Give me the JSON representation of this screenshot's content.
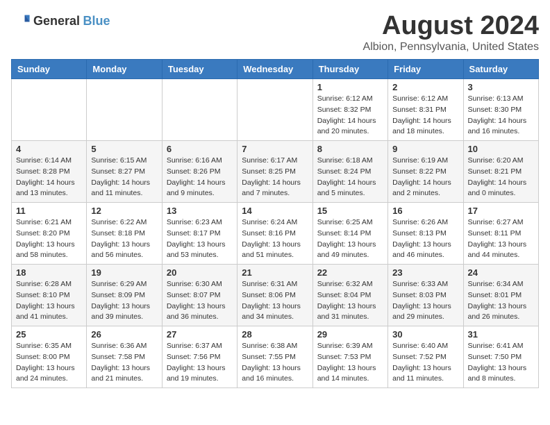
{
  "header": {
    "logo_general": "General",
    "logo_blue": "Blue",
    "title": "August 2024",
    "subtitle": "Albion, Pennsylvania, United States"
  },
  "weekdays": [
    "Sunday",
    "Monday",
    "Tuesday",
    "Wednesday",
    "Thursday",
    "Friday",
    "Saturday"
  ],
  "weeks": [
    [
      {
        "day": "",
        "sunrise": "",
        "sunset": "",
        "daylight": ""
      },
      {
        "day": "",
        "sunrise": "",
        "sunset": "",
        "daylight": ""
      },
      {
        "day": "",
        "sunrise": "",
        "sunset": "",
        "daylight": ""
      },
      {
        "day": "",
        "sunrise": "",
        "sunset": "",
        "daylight": ""
      },
      {
        "day": "1",
        "sunrise": "Sunrise: 6:12 AM",
        "sunset": "Sunset: 8:32 PM",
        "daylight": "Daylight: 14 hours and 20 minutes."
      },
      {
        "day": "2",
        "sunrise": "Sunrise: 6:12 AM",
        "sunset": "Sunset: 8:31 PM",
        "daylight": "Daylight: 14 hours and 18 minutes."
      },
      {
        "day": "3",
        "sunrise": "Sunrise: 6:13 AM",
        "sunset": "Sunset: 8:30 PM",
        "daylight": "Daylight: 14 hours and 16 minutes."
      }
    ],
    [
      {
        "day": "4",
        "sunrise": "Sunrise: 6:14 AM",
        "sunset": "Sunset: 8:28 PM",
        "daylight": "Daylight: 14 hours and 13 minutes."
      },
      {
        "day": "5",
        "sunrise": "Sunrise: 6:15 AM",
        "sunset": "Sunset: 8:27 PM",
        "daylight": "Daylight: 14 hours and 11 minutes."
      },
      {
        "day": "6",
        "sunrise": "Sunrise: 6:16 AM",
        "sunset": "Sunset: 8:26 PM",
        "daylight": "Daylight: 14 hours and 9 minutes."
      },
      {
        "day": "7",
        "sunrise": "Sunrise: 6:17 AM",
        "sunset": "Sunset: 8:25 PM",
        "daylight": "Daylight: 14 hours and 7 minutes."
      },
      {
        "day": "8",
        "sunrise": "Sunrise: 6:18 AM",
        "sunset": "Sunset: 8:24 PM",
        "daylight": "Daylight: 14 hours and 5 minutes."
      },
      {
        "day": "9",
        "sunrise": "Sunrise: 6:19 AM",
        "sunset": "Sunset: 8:22 PM",
        "daylight": "Daylight: 14 hours and 2 minutes."
      },
      {
        "day": "10",
        "sunrise": "Sunrise: 6:20 AM",
        "sunset": "Sunset: 8:21 PM",
        "daylight": "Daylight: 14 hours and 0 minutes."
      }
    ],
    [
      {
        "day": "11",
        "sunrise": "Sunrise: 6:21 AM",
        "sunset": "Sunset: 8:20 PM",
        "daylight": "Daylight: 13 hours and 58 minutes."
      },
      {
        "day": "12",
        "sunrise": "Sunrise: 6:22 AM",
        "sunset": "Sunset: 8:18 PM",
        "daylight": "Daylight: 13 hours and 56 minutes."
      },
      {
        "day": "13",
        "sunrise": "Sunrise: 6:23 AM",
        "sunset": "Sunset: 8:17 PM",
        "daylight": "Daylight: 13 hours and 53 minutes."
      },
      {
        "day": "14",
        "sunrise": "Sunrise: 6:24 AM",
        "sunset": "Sunset: 8:16 PM",
        "daylight": "Daylight: 13 hours and 51 minutes."
      },
      {
        "day": "15",
        "sunrise": "Sunrise: 6:25 AM",
        "sunset": "Sunset: 8:14 PM",
        "daylight": "Daylight: 13 hours and 49 minutes."
      },
      {
        "day": "16",
        "sunrise": "Sunrise: 6:26 AM",
        "sunset": "Sunset: 8:13 PM",
        "daylight": "Daylight: 13 hours and 46 minutes."
      },
      {
        "day": "17",
        "sunrise": "Sunrise: 6:27 AM",
        "sunset": "Sunset: 8:11 PM",
        "daylight": "Daylight: 13 hours and 44 minutes."
      }
    ],
    [
      {
        "day": "18",
        "sunrise": "Sunrise: 6:28 AM",
        "sunset": "Sunset: 8:10 PM",
        "daylight": "Daylight: 13 hours and 41 minutes."
      },
      {
        "day": "19",
        "sunrise": "Sunrise: 6:29 AM",
        "sunset": "Sunset: 8:09 PM",
        "daylight": "Daylight: 13 hours and 39 minutes."
      },
      {
        "day": "20",
        "sunrise": "Sunrise: 6:30 AM",
        "sunset": "Sunset: 8:07 PM",
        "daylight": "Daylight: 13 hours and 36 minutes."
      },
      {
        "day": "21",
        "sunrise": "Sunrise: 6:31 AM",
        "sunset": "Sunset: 8:06 PM",
        "daylight": "Daylight: 13 hours and 34 minutes."
      },
      {
        "day": "22",
        "sunrise": "Sunrise: 6:32 AM",
        "sunset": "Sunset: 8:04 PM",
        "daylight": "Daylight: 13 hours and 31 minutes."
      },
      {
        "day": "23",
        "sunrise": "Sunrise: 6:33 AM",
        "sunset": "Sunset: 8:03 PM",
        "daylight": "Daylight: 13 hours and 29 minutes."
      },
      {
        "day": "24",
        "sunrise": "Sunrise: 6:34 AM",
        "sunset": "Sunset: 8:01 PM",
        "daylight": "Daylight: 13 hours and 26 minutes."
      }
    ],
    [
      {
        "day": "25",
        "sunrise": "Sunrise: 6:35 AM",
        "sunset": "Sunset: 8:00 PM",
        "daylight": "Daylight: 13 hours and 24 minutes."
      },
      {
        "day": "26",
        "sunrise": "Sunrise: 6:36 AM",
        "sunset": "Sunset: 7:58 PM",
        "daylight": "Daylight: 13 hours and 21 minutes."
      },
      {
        "day": "27",
        "sunrise": "Sunrise: 6:37 AM",
        "sunset": "Sunset: 7:56 PM",
        "daylight": "Daylight: 13 hours and 19 minutes."
      },
      {
        "day": "28",
        "sunrise": "Sunrise: 6:38 AM",
        "sunset": "Sunset: 7:55 PM",
        "daylight": "Daylight: 13 hours and 16 minutes."
      },
      {
        "day": "29",
        "sunrise": "Sunrise: 6:39 AM",
        "sunset": "Sunset: 7:53 PM",
        "daylight": "Daylight: 13 hours and 14 minutes."
      },
      {
        "day": "30",
        "sunrise": "Sunrise: 6:40 AM",
        "sunset": "Sunset: 7:52 PM",
        "daylight": "Daylight: 13 hours and 11 minutes."
      },
      {
        "day": "31",
        "sunrise": "Sunrise: 6:41 AM",
        "sunset": "Sunset: 7:50 PM",
        "daylight": "Daylight: 13 hours and 8 minutes."
      }
    ]
  ]
}
